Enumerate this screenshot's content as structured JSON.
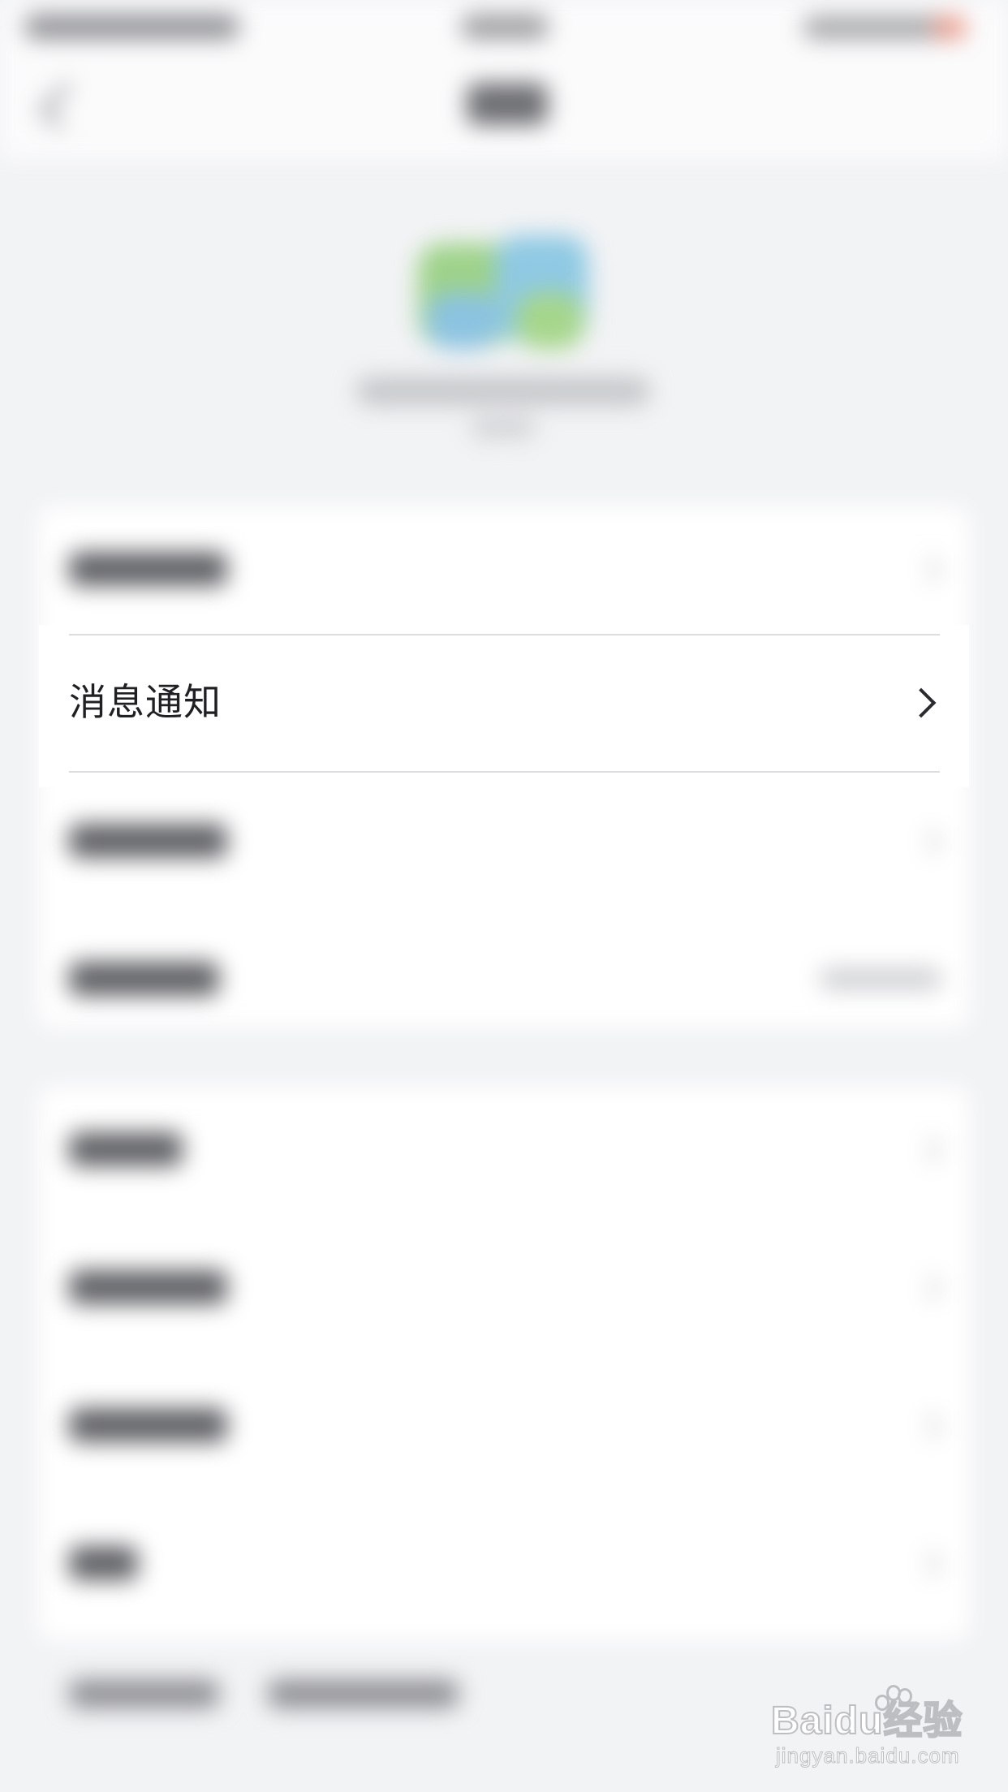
{
  "settings_list": {
    "focused_item": {
      "label": "消息通知"
    }
  },
  "watermark": {
    "brand": "Baidu经验",
    "url": "jingyan.baidu.com"
  },
  "colors": {
    "background": "#f2f3f5",
    "card": "#ffffff",
    "text": "#1f2024",
    "divider": "#dcdde0",
    "logo_green": "#9ed28a",
    "logo_blue": "#8fc9e3"
  }
}
